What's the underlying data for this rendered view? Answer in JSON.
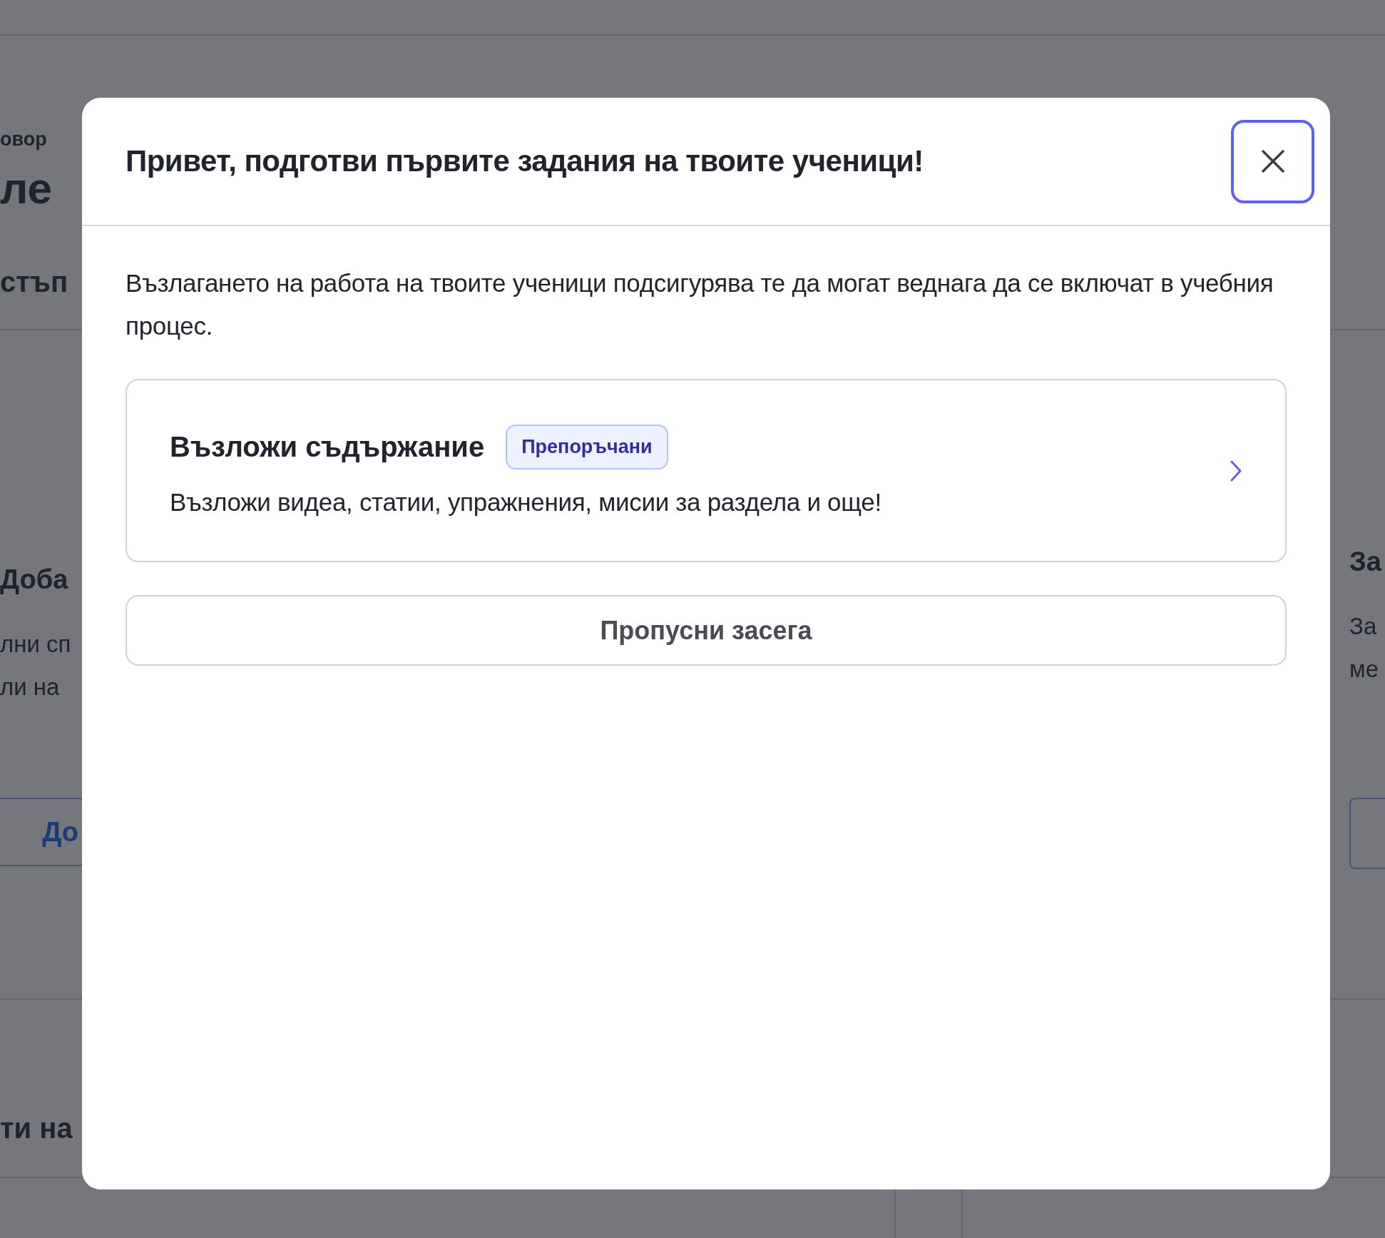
{
  "background_page": {
    "breadcrumb": "овор",
    "heading": "ле",
    "subheading": "стъп",
    "left_card": {
      "title": "Доба",
      "lines": [
        "лни сп",
        "ли на"
      ],
      "button": "До"
    },
    "right_card": {
      "title": "За",
      "lines": [
        "За",
        "ме"
      ]
    },
    "section_heading": "ти на"
  },
  "dialog": {
    "title": "Привет, подготви първите задания на твоите ученици!",
    "description": "Възлагането на работа на твоите ученици подсигурява те да могат веднага да се включат в учебния процес.",
    "options": [
      {
        "title": "Възложи съдържание",
        "badge": "Препоръчани",
        "description": "Възложи видеа, статии, упражнения, мисии за раздела и още!"
      }
    ],
    "skip_button": "Пропусни засега"
  }
}
